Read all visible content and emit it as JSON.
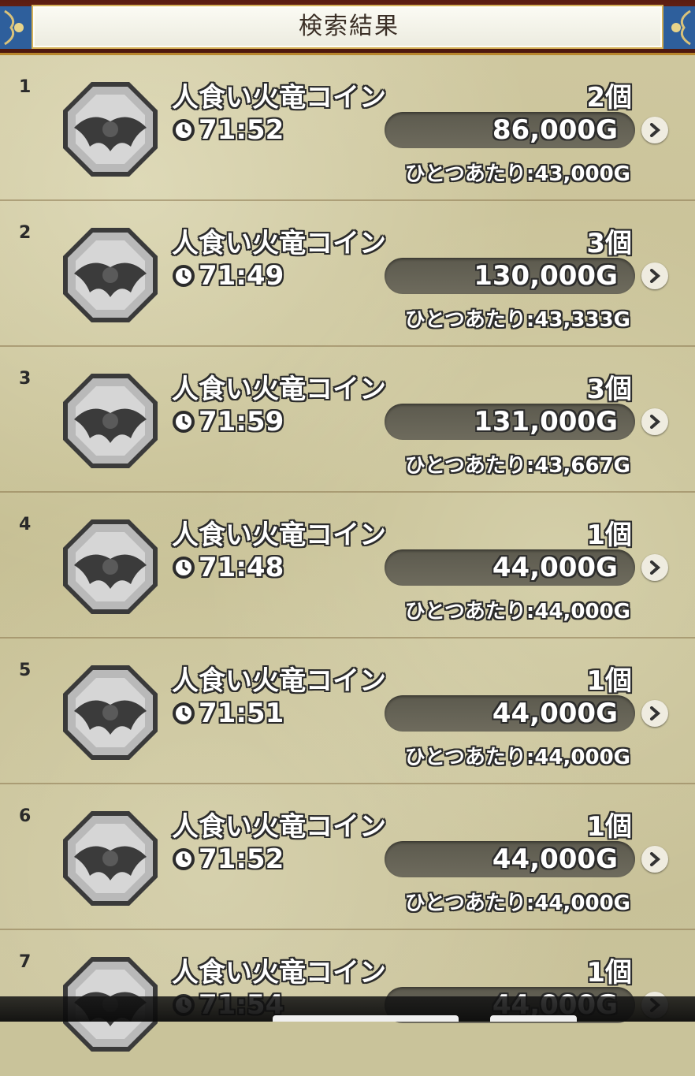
{
  "header": {
    "title": "検索結果"
  },
  "icons": {
    "clock": "clock-icon",
    "chevron": "chevron-right-icon",
    "coin": "dragon-coin-icon"
  },
  "rows": [
    {
      "index": "1",
      "name": "人食い火竜コイン",
      "quantity": "2個",
      "time": "71:52",
      "price": "86,000G",
      "unit_price": "ひとつあたり:43,000G"
    },
    {
      "index": "2",
      "name": "人食い火竜コイン",
      "quantity": "3個",
      "time": "71:49",
      "price": "130,000G",
      "unit_price": "ひとつあたり:43,333G"
    },
    {
      "index": "3",
      "name": "人食い火竜コイン",
      "quantity": "3個",
      "time": "71:59",
      "price": "131,000G",
      "unit_price": "ひとつあたり:43,667G"
    },
    {
      "index": "4",
      "name": "人食い火竜コイン",
      "quantity": "1個",
      "time": "71:48",
      "price": "44,000G",
      "unit_price": "ひとつあたり:44,000G"
    },
    {
      "index": "5",
      "name": "人食い火竜コイン",
      "quantity": "1個",
      "time": "71:51",
      "price": "44,000G",
      "unit_price": "ひとつあたり:44,000G"
    },
    {
      "index": "6",
      "name": "人食い火竜コイン",
      "quantity": "1個",
      "time": "71:52",
      "price": "44,000G",
      "unit_price": "ひとつあたり:44,000G"
    },
    {
      "index": "7",
      "name": "人食い火竜コイン",
      "quantity": "1個",
      "time": "71:54",
      "price": "44,000G",
      "unit_price": ""
    }
  ]
}
